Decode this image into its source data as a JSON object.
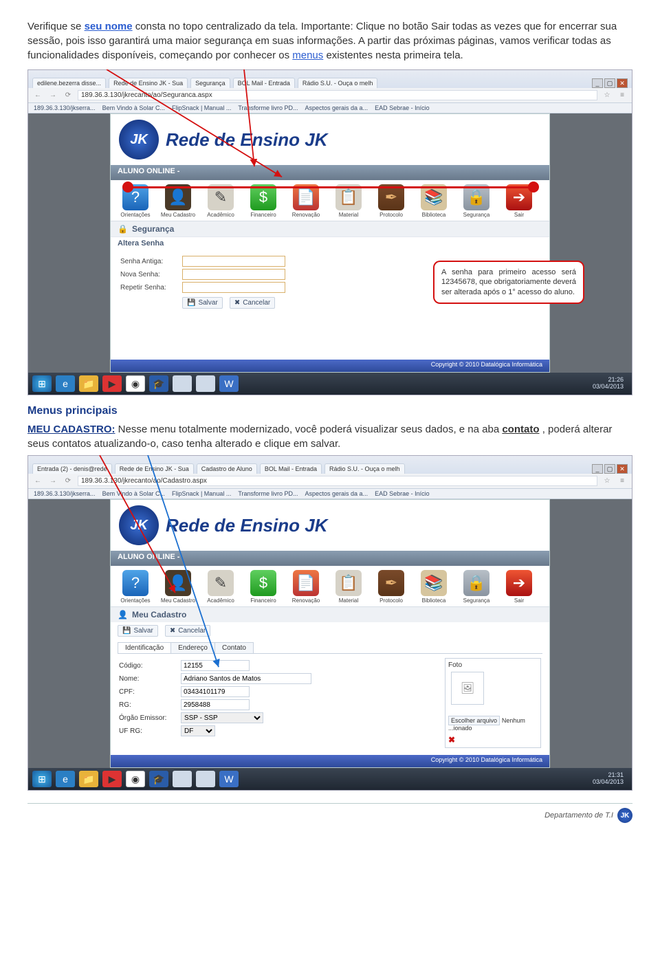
{
  "intro": {
    "t1a": "Verifique se ",
    "t1b": "seu nome",
    "t1c": " consta no topo centralizado da tela. Importante: Clique no botão Sair todas as vezes que for encerrar sua sessão, pois isso garantirá uma maior segurança em suas informações. A partir das próximas páginas, vamos verificar todas as funcionalidades disponíveis, começando por conhecer os ",
    "t1d": "menus",
    "t1e": " existentes nesta primeira tela."
  },
  "browser1": {
    "tabs": [
      "edilene.bezerra disse...",
      "Rede de Ensino JK - Sua",
      "Segurança",
      "BOL Mail - Entrada",
      "Rádio S.U. - Ouça o melh"
    ],
    "addr": "189.36.3.130/jkrecanto/ao/Seguranca.aspx",
    "bookmarks": [
      "189.36.3.130/jkserra...",
      "Bem Vindo à Solar C...",
      "FlipSnack | Manual ...",
      "Transforme livro PD...",
      "Aspectos gerais da a...",
      "EAD Sebrae - Início"
    ]
  },
  "portal": {
    "title": "Rede de Ensino JK",
    "bar": "ALUNO ONLINE -",
    "icons": [
      {
        "cls": "orientacoes",
        "sym": "?",
        "lbl": "Orientações"
      },
      {
        "cls": "cadastro",
        "sym": "👤",
        "lbl": "Meu Cadastro"
      },
      {
        "cls": "academico",
        "sym": "✎",
        "lbl": "Acadêmico"
      },
      {
        "cls": "financeiro",
        "sym": "$",
        "lbl": "Financeiro"
      },
      {
        "cls": "renovacao",
        "sym": "📄",
        "lbl": "Renovação"
      },
      {
        "cls": "material",
        "sym": "📋",
        "lbl": "Material"
      },
      {
        "cls": "protocolo",
        "sym": "✒",
        "lbl": "Protocolo"
      },
      {
        "cls": "biblioteca",
        "sym": "📚",
        "lbl": "Biblioteca"
      },
      {
        "cls": "seguranca",
        "sym": "🔒",
        "lbl": "Segurança"
      },
      {
        "cls": "sair",
        "sym": "➔",
        "lbl": "Sair"
      }
    ],
    "panel1_hdr": "Segurança",
    "panel1_sub": "Altera Senha",
    "form1": {
      "f1": "Senha Antiga:",
      "f2": "Nova Senha:",
      "f3": "Repetir Senha:"
    },
    "btn_save": "Salvar",
    "btn_cancel": "Cancelar",
    "copyright": "Copyright © 2010 Datalógica Informática"
  },
  "taskbar1": {
    "time": "21:26",
    "date": "03/04/2013"
  },
  "callout_text": "A senha para primeiro acesso será 12345678, que obrigatoriamente deverá ser alterada após o 1° acesso do aluno.",
  "section2": {
    "hdr": "Menus principais",
    "p1a": "MEU CADASTRO:",
    "p1b": " Nesse menu totalmente modernizado, você poderá visualizar seus dados, e na aba ",
    "p1c": "contato",
    "p1d": ", poderá alterar seus contatos atualizando-o, caso tenha alterado e clique em salvar."
  },
  "browser2": {
    "tabs": [
      "Entrada (2) - denis@rede",
      "Rede de Ensino JK - Sua",
      "Cadastro de Aluno",
      "BOL Mail - Entrada",
      "Rádio S.U. - Ouça o melh"
    ],
    "addr": "189.36.3.130/jkrecanto/ao/Cadastro.aspx",
    "bookmarks": [
      "189.36.3.130/jkserra...",
      "Bem Vindo à Solar C...",
      "FlipSnack | Manual ...",
      "Transforme livro PD...",
      "Aspectos gerais da a...",
      "EAD Sebrae - Início"
    ]
  },
  "panel2_hdr": "Meu Cadastro",
  "tabs2": [
    "Identificação",
    "Endereço",
    "Contato"
  ],
  "form2": {
    "codigo_l": "Código:",
    "codigo_v": "12155",
    "nome_l": "Nome:",
    "nome_v": "Adriano Santos de Matos",
    "cpf_l": "CPF:",
    "cpf_v": "03434101179",
    "rg_l": "RG:",
    "rg_v": "2958488",
    "orgao_l": "Órgão Emissor:",
    "orgao_v": "SSP - SSP",
    "uf_l": "UF RG:",
    "uf_v": "DF"
  },
  "foto": {
    "legend": "Foto",
    "btn": "Escolher arquivo",
    "none": "Nenhum ...ionado"
  },
  "taskbar2": {
    "time": "21:31",
    "date": "03/04/2013"
  },
  "footer": "Departamento de T.I"
}
